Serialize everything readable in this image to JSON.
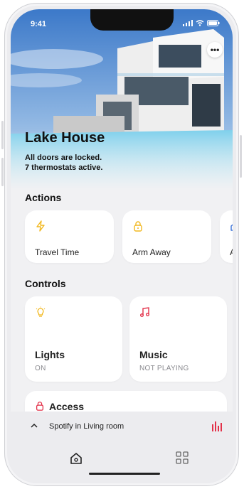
{
  "status_bar": {
    "time": "9:41"
  },
  "header": {
    "title": "Lake House",
    "subtitle_line1": "All doors are locked.",
    "subtitle_line2": "7 thermostats active.",
    "more_label": "•••"
  },
  "actions": {
    "title": "Actions",
    "items": [
      {
        "label": "Travel Time",
        "icon": "lightning-icon"
      },
      {
        "label": "Arm Away",
        "icon": "lock-icon"
      },
      {
        "label": "Ar",
        "icon": "home-icon"
      }
    ]
  },
  "controls": {
    "title": "Controls",
    "items": [
      {
        "label": "Lights",
        "status": "ON",
        "icon": "lightbulb-icon"
      },
      {
        "label": "Music",
        "status": "NOT PLAYING",
        "icon": "music-note-icon"
      }
    ],
    "access": {
      "label": "Access",
      "icon": "lock-icon"
    }
  },
  "player": {
    "text": "Spotify in Living room",
    "chevron": "^"
  },
  "tabbar": {
    "items": [
      {
        "icon": "home-icon"
      },
      {
        "icon": "grid-icon"
      }
    ]
  },
  "colors": {
    "accent_yellow": "#f2b81f",
    "accent_red": "#e3324a",
    "background": "#f1f1f3"
  }
}
